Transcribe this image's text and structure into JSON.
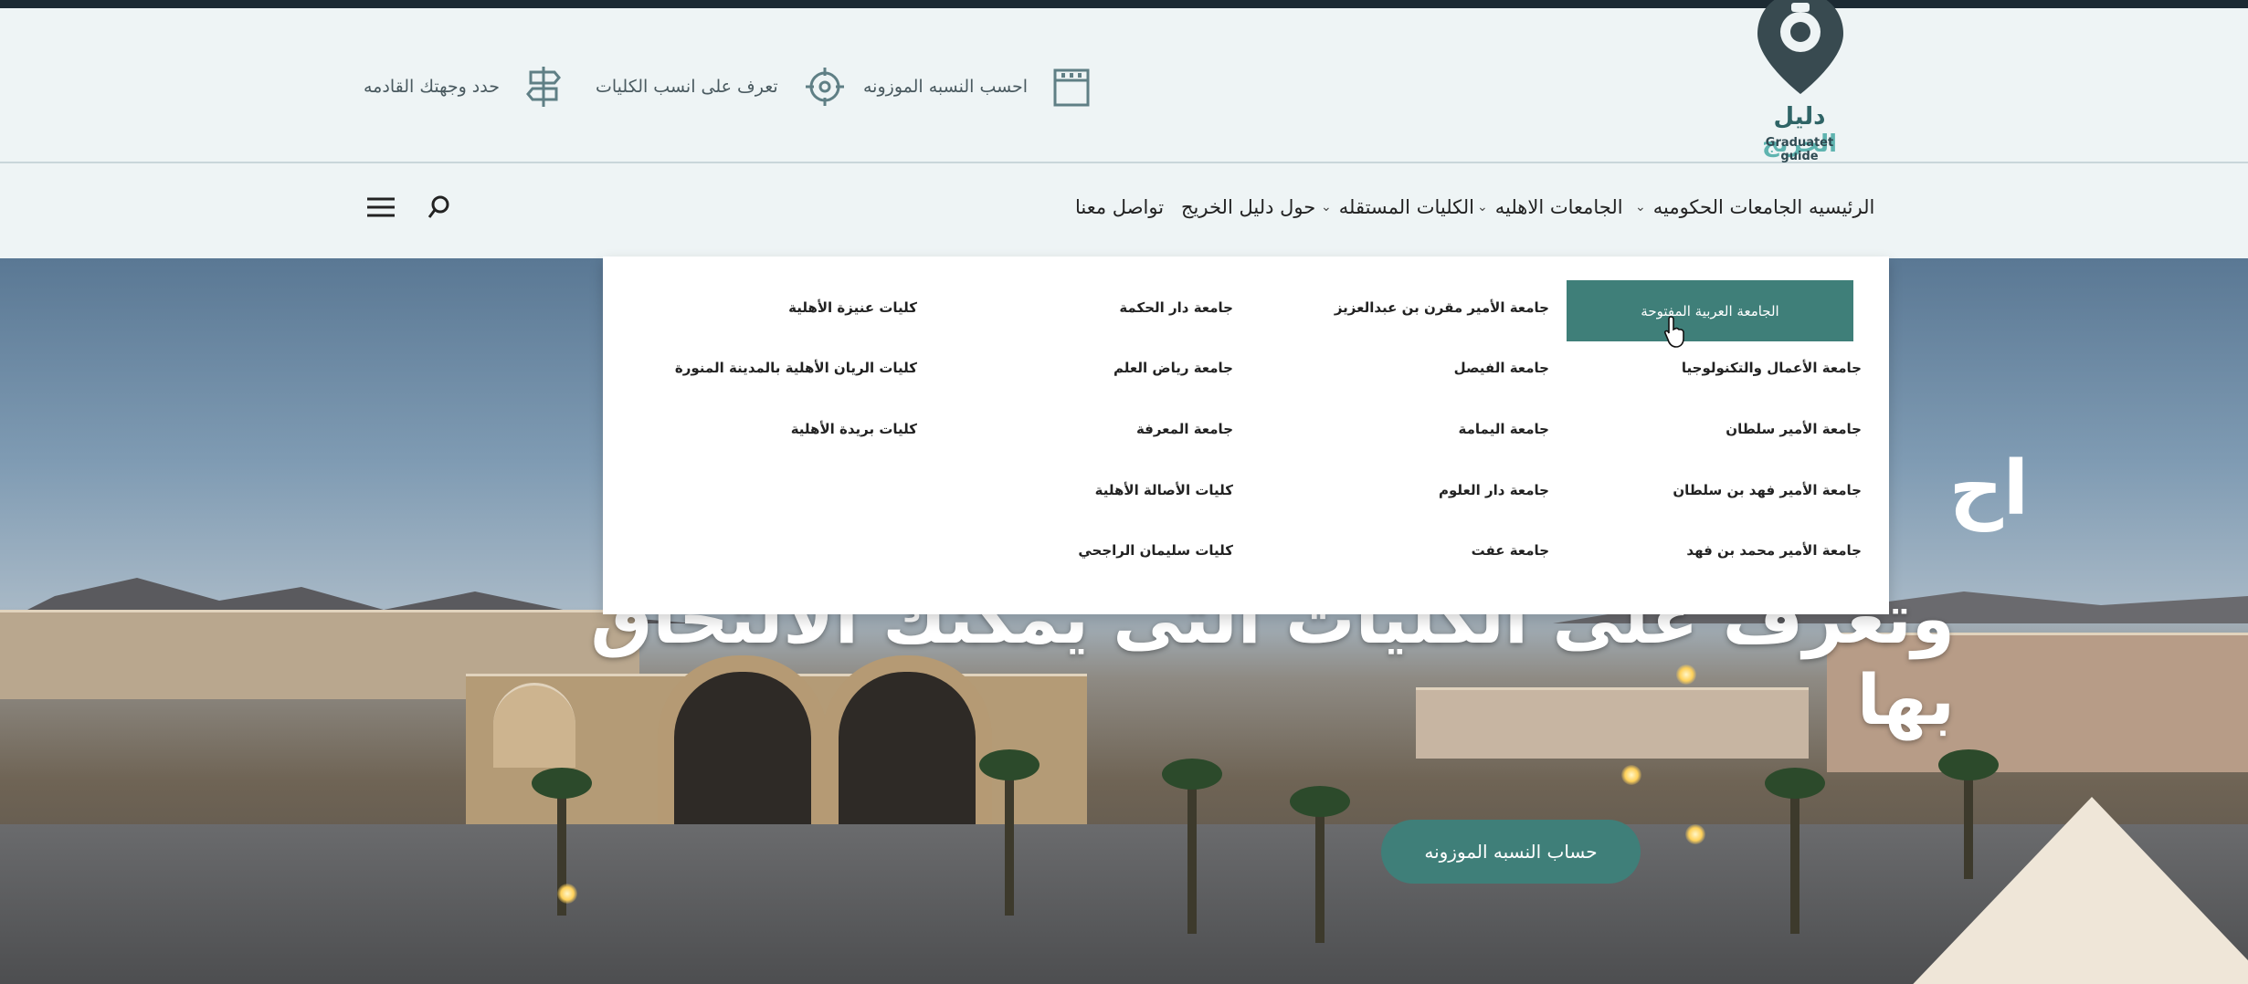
{
  "logo": {
    "name_ar_main": "دليل",
    "name_ar_accent": "الخريج",
    "name_en": "Graduatet guide"
  },
  "utility_links": [
    {
      "label": "احسب النسبه الموزونه",
      "icon": "calendar-icon"
    },
    {
      "label": "تعرف على انسب الكليات",
      "icon": "target-icon"
    },
    {
      "label": "حدد وجهتك القادمه",
      "icon": "signpost-icon"
    }
  ],
  "nav": {
    "items": [
      {
        "label": "الرئيسيه",
        "dropdown": false
      },
      {
        "label": "الجامعات الحكوميه",
        "dropdown": true
      },
      {
        "label": "الجامعات الاهليه",
        "dropdown": true
      },
      {
        "label": "الكليات المستقله",
        "dropdown": true
      },
      {
        "label": "حول دليل الخريج",
        "dropdown": false
      },
      {
        "label": "تواصل معنا",
        "dropdown": false
      }
    ],
    "search_icon": "search-icon",
    "menu_icon": "hamburger-menu-icon"
  },
  "dropdown": {
    "columns": [
      [
        "الجامعة العربية المفتوحة",
        "جامعة الأعمال والتكنولوجيا",
        "جامعة الأمير سلطان",
        "جامعة الأمير فهد بن سلطان",
        "جامعة الأمير محمد بن فهد"
      ],
      [
        "جامعة الأمير مقرن بن عبدالعزيز",
        "جامعة الفيصل",
        "جامعة اليمامة",
        "جامعة دار العلوم",
        "جامعة عفت"
      ],
      [
        "جامعة دار الحكمة",
        "جامعة رياض العلم",
        "جامعة المعرفة",
        "كليات الأصالة الأهلية",
        "كليات سليمان الراجحي"
      ],
      [
        "كليات عنيزة الأهلية",
        "كليات الريان الأهلية بالمدينة المنورة",
        "كليات بريدة الأهلية"
      ]
    ],
    "active_item": "الجامعة العربية المفتوحة"
  },
  "hero": {
    "headline_line1": "اح",
    "headline_line2": "وتعرف على الكليات التى يمكنك الالتحاق بها",
    "cta_label": "حساب النسبه الموزونه"
  },
  "colors": {
    "accent": "#3f7f79",
    "dark_strip": "#1c2a33",
    "header_bg": "#eef4f5"
  }
}
